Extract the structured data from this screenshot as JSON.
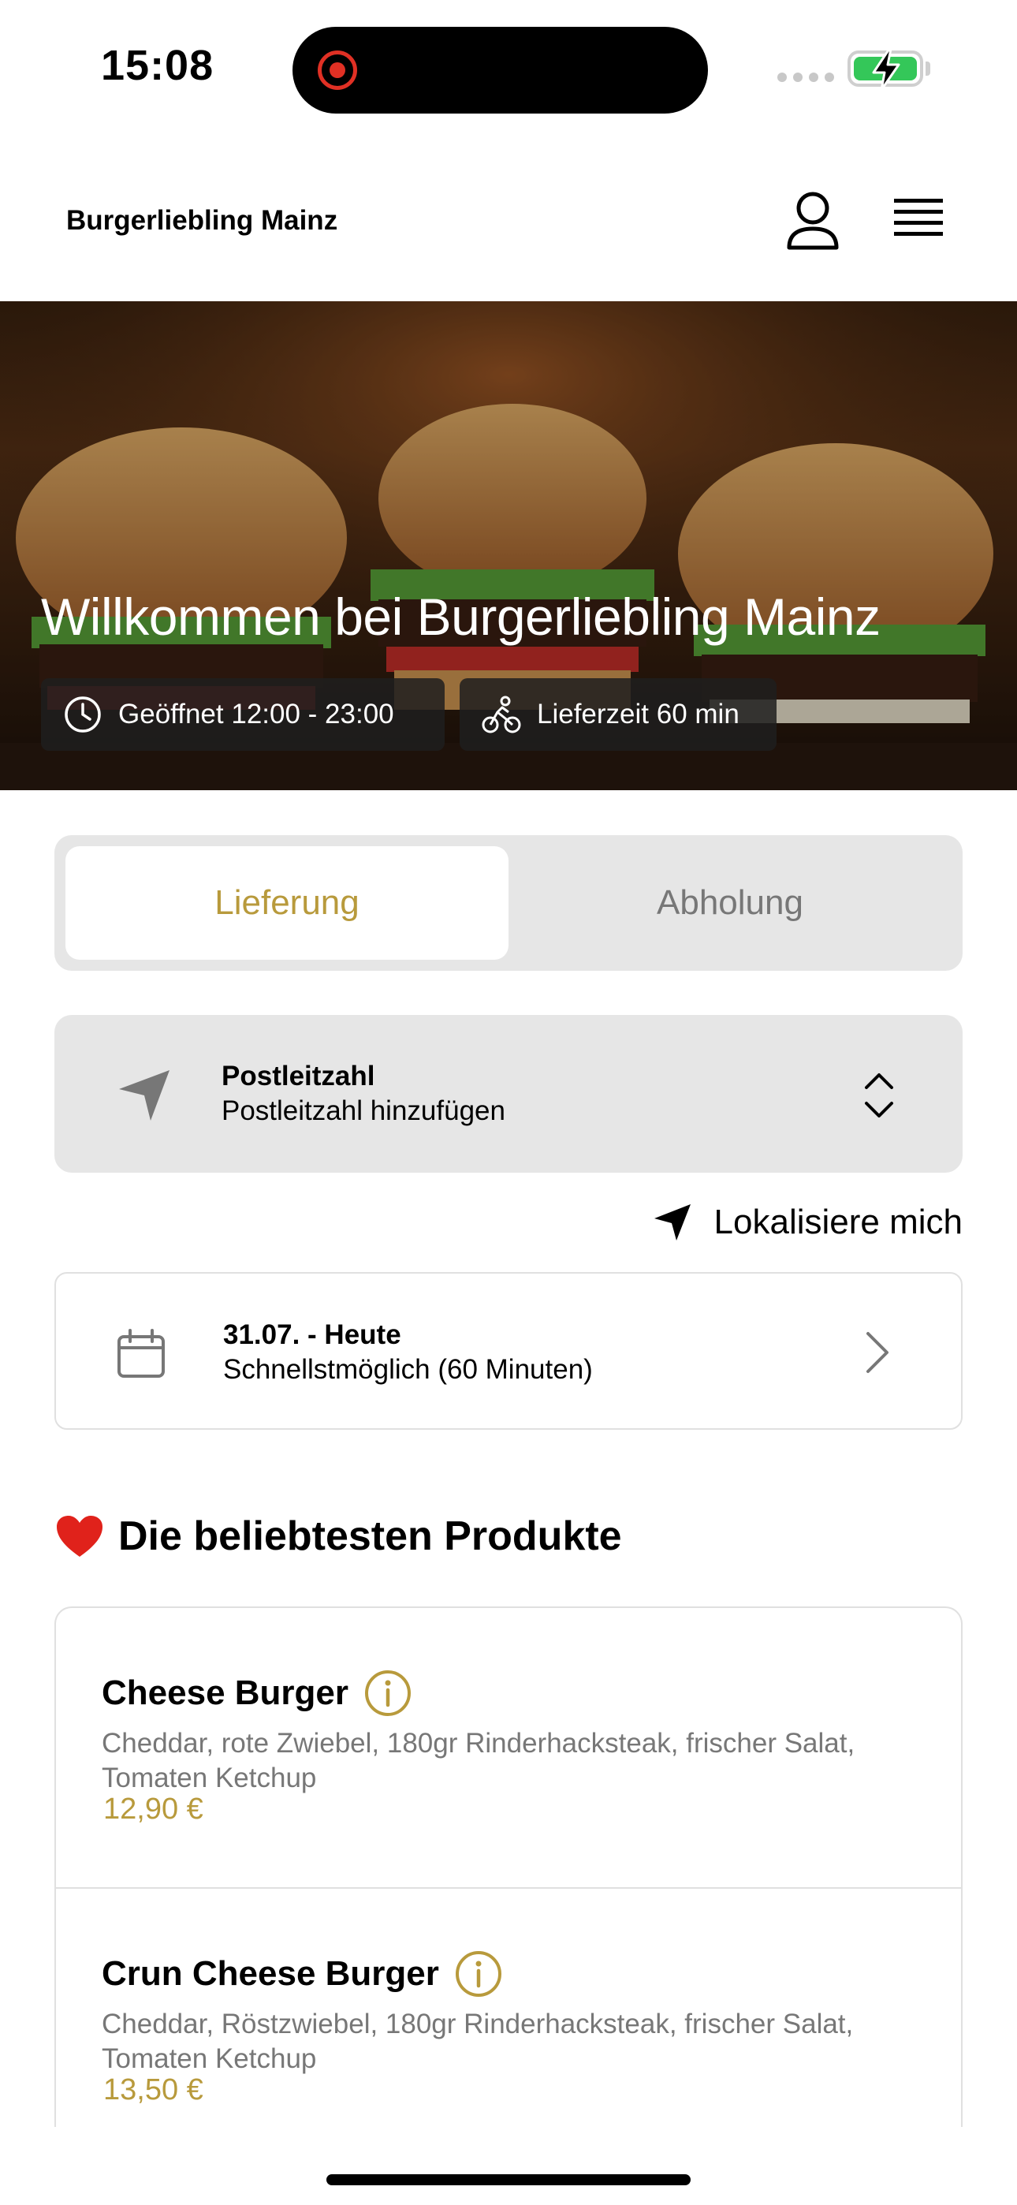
{
  "status_bar": {
    "time": "15:08"
  },
  "header": {
    "title": "Burgerliebling Mainz"
  },
  "hero": {
    "title": "Willkommen bei Burgerliebling Mainz",
    "hours": "Geöffnet 12:00 - 23:00",
    "delivery_time": "Lieferzeit 60 min"
  },
  "mode": {
    "options": [
      "Lieferung",
      "Abholung"
    ],
    "selected": "Lieferung"
  },
  "postcode": {
    "label": "Postleitzahl",
    "placeholder": "Postleitzahl hinzufügen"
  },
  "locate": {
    "label": "Lokalisiere mich"
  },
  "date": {
    "label": "31.07. - Heute",
    "value": "Schnellstmöglich (60 Minuten)"
  },
  "popular": {
    "title": "Die beliebtesten Produkte",
    "products": [
      {
        "name": "Cheese Burger",
        "description": "Cheddar, rote Zwiebel, 180gr Rinderhacksteak, frischer Salat, Tomaten Ketchup",
        "price": "12,90 €"
      },
      {
        "name": "Crun Cheese Burger",
        "description": "Cheddar, Röstzwiebel, 180gr Rinderhacksteak, frischer Salat, Tomaten Ketchup",
        "price": "13,50 €"
      }
    ]
  },
  "colors": {
    "accent": "#b89a3c",
    "panel": "#e6e6e6"
  },
  "icons": [
    "record-icon",
    "battery-icon",
    "profile-icon",
    "menu-icon",
    "clock-icon",
    "bike-icon",
    "navigation-arrow-icon",
    "chevron-updown-icon",
    "location-arrow-icon",
    "calendar-icon",
    "chevron-right-icon",
    "heart-icon",
    "info-icon"
  ]
}
